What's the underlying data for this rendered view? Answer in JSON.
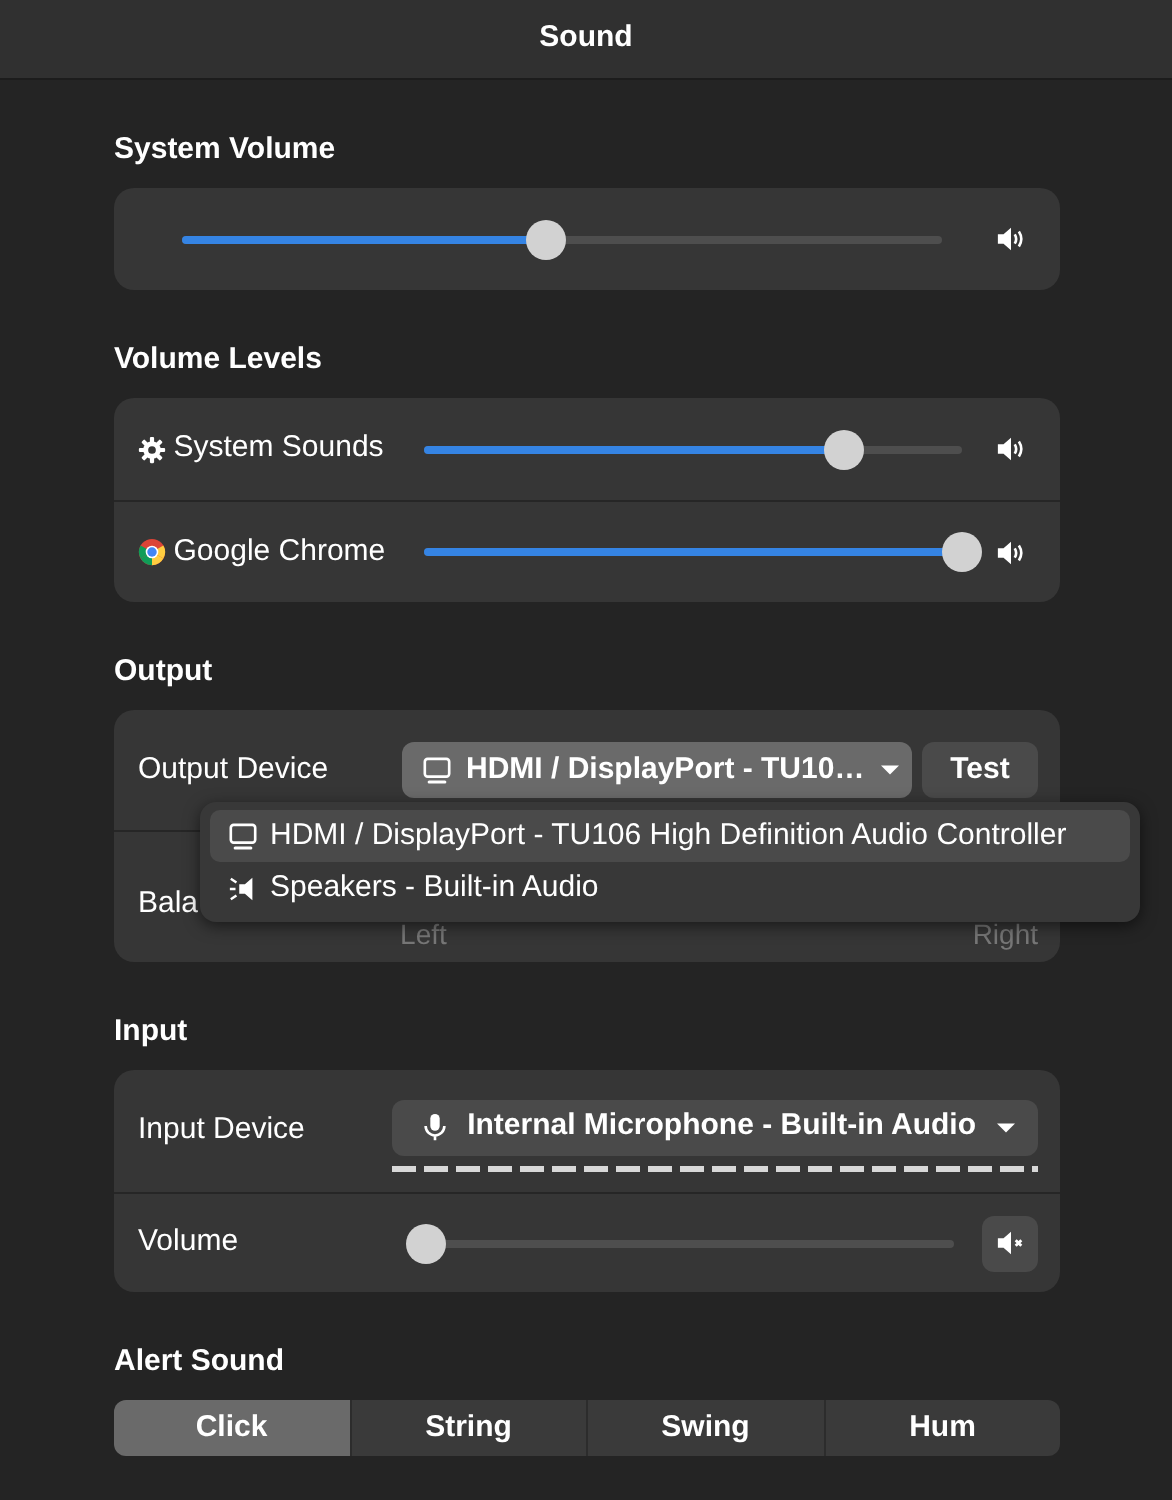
{
  "window": {
    "title": "Sound"
  },
  "system_volume": {
    "title": "System Volume",
    "level": 0.48,
    "muted": false
  },
  "volume_levels": {
    "title": "Volume Levels",
    "apps": [
      {
        "name": "System Sounds",
        "kind": "gear",
        "level": 0.78,
        "muted": false
      },
      {
        "name": "Google Chrome",
        "kind": "browser",
        "level": 1.0,
        "muted": false
      }
    ]
  },
  "output": {
    "title": "Output",
    "device_label": "Output Device",
    "device": "HDMI / DisplayPort - TU10…",
    "test_button": "Test",
    "balance_label": "Bala",
    "balance_left": "Left",
    "balance_right": "Right",
    "menu": [
      {
        "label": "HDMI / DisplayPort - TU106 High Definition Audio Controller",
        "kind": "monitor",
        "selected": true
      },
      {
        "label": "Speakers - Built-in Audio",
        "kind": "speaker",
        "selected": false
      }
    ]
  },
  "input": {
    "title": "Input",
    "device_label": "Input Device",
    "device": "Internal Microphone - Built-in Audio",
    "volume_label": "Volume",
    "level": 0,
    "muted": true
  },
  "alert_sound": {
    "title": "Alert Sound",
    "options": [
      {
        "label": "Click",
        "selected": true
      },
      {
        "label": "String",
        "selected": false
      },
      {
        "label": "Swing",
        "selected": false
      },
      {
        "label": "Hum",
        "selected": false
      }
    ]
  }
}
